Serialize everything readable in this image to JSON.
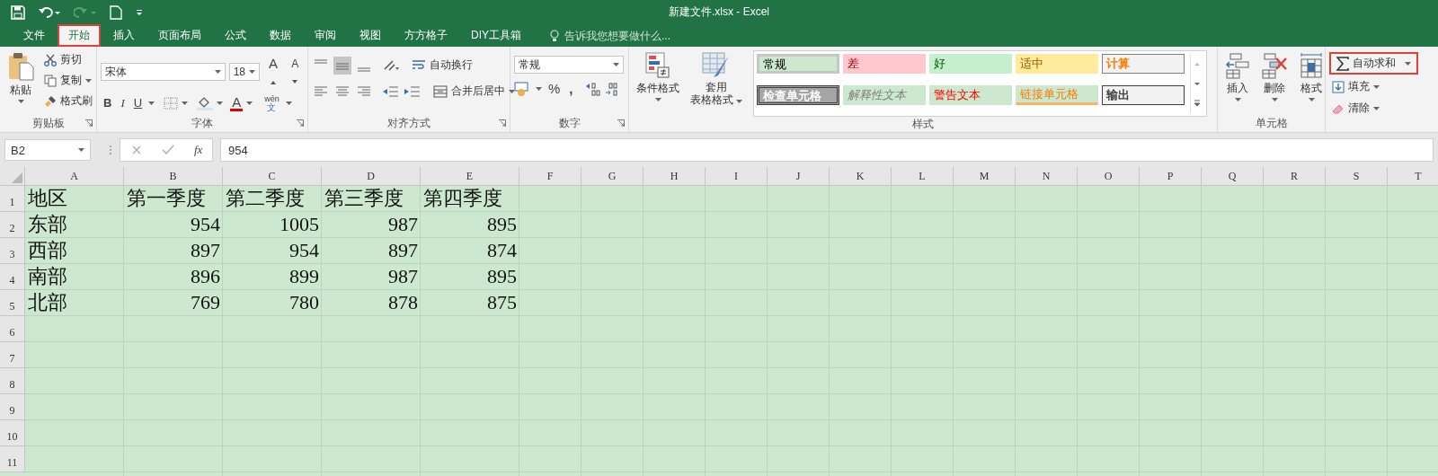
{
  "window": {
    "title": "新建文件.xlsx - Excel"
  },
  "tabs": [
    {
      "label": "文件",
      "selected": false,
      "highlighted": false
    },
    {
      "label": "开始",
      "selected": true,
      "highlighted": true
    },
    {
      "label": "插入",
      "selected": false,
      "highlighted": false
    },
    {
      "label": "页面布局",
      "selected": false,
      "highlighted": false
    },
    {
      "label": "公式",
      "selected": false,
      "highlighted": false
    },
    {
      "label": "数据",
      "selected": false,
      "highlighted": false
    },
    {
      "label": "审阅",
      "selected": false,
      "highlighted": false
    },
    {
      "label": "视图",
      "selected": false,
      "highlighted": false
    },
    {
      "label": "方方格子",
      "selected": false,
      "highlighted": false
    },
    {
      "label": "DIY工具箱",
      "selected": false,
      "highlighted": false
    }
  ],
  "tell_me": {
    "placeholder": "告诉我您想要做什么..."
  },
  "ribbon": {
    "clipboard": {
      "label": "剪贴板",
      "paste": "粘贴",
      "cut": "剪切",
      "copy": "复制",
      "format_painter": "格式刷"
    },
    "font": {
      "label": "字体",
      "font_name": "宋体",
      "font_size": "18",
      "grow_font": "A",
      "shrink_font": "A",
      "bold": "B",
      "italic": "I",
      "underline": "U",
      "font_color": "A",
      "phonetic_top": "wén",
      "phonetic_bottom": "文"
    },
    "alignment": {
      "label": "对齐方式",
      "vertical_align": [
        {
          "selected": false
        },
        {
          "selected": true
        },
        {
          "selected": false
        }
      ],
      "wrap_text": "自动换行",
      "merge_center": "合并后居中"
    },
    "number": {
      "label": "数字",
      "format": "常规",
      "percent": "%",
      "comma": ","
    },
    "styles": {
      "label": "样式",
      "conditional_formatting": "条件格式",
      "format_as_table": [
        "套用",
        "表格格式"
      ],
      "cell_styles": [
        {
          "label": "常规",
          "kind": "normal",
          "selected": true
        },
        {
          "label": "差",
          "kind": "bad",
          "selected": false
        },
        {
          "label": "好",
          "kind": "good",
          "selected": false
        },
        {
          "label": "适中",
          "kind": "neutral",
          "selected": false
        },
        {
          "label": "计算",
          "kind": "calculation",
          "selected": false
        },
        {
          "label": "检查单元格",
          "kind": "check_cell",
          "selected": false
        },
        {
          "label": "解释性文本",
          "kind": "explanatory",
          "selected": false
        },
        {
          "label": "警告文本",
          "kind": "warning",
          "selected": false
        },
        {
          "label": "链接单元格",
          "kind": "linked_cell",
          "selected": false
        },
        {
          "label": "输出",
          "kind": "output",
          "selected": false
        }
      ]
    },
    "cells": {
      "label": "单元格",
      "insert": "插入",
      "delete": "删除",
      "format": "格式"
    },
    "editing": {
      "autosum": "自动求和",
      "autosum_highlighted": true,
      "fill": "填充",
      "clear": "清除"
    }
  },
  "formula_bar": {
    "name_box": "B2",
    "function_label": "fx",
    "formula": "954"
  },
  "sheet": {
    "columns": [
      "A",
      "B",
      "C",
      "D",
      "E",
      "F",
      "G",
      "H",
      "I",
      "J",
      "K",
      "L",
      "M",
      "N",
      "O",
      "P",
      "Q",
      "R",
      "S",
      "T"
    ],
    "rows": [
      {
        "header": "1",
        "kind": "header",
        "cells": [
          "地区",
          "第一季度",
          "第二季度",
          "第三季度",
          "第四季度"
        ]
      },
      {
        "header": "2",
        "kind": "data",
        "cells": [
          "东部",
          "954",
          "1005",
          "987",
          "895"
        ]
      },
      {
        "header": "3",
        "kind": "data",
        "cells": [
          "西部",
          "897",
          "954",
          "897",
          "874"
        ]
      },
      {
        "header": "4",
        "kind": "data",
        "cells": [
          "南部",
          "896",
          "899",
          "987",
          "895"
        ]
      },
      {
        "header": "5",
        "kind": "data",
        "cells": [
          "北部",
          "769",
          "780",
          "878",
          "875"
        ]
      },
      {
        "header": "6",
        "kind": "data",
        "cells": []
      },
      {
        "header": "7",
        "kind": "data",
        "cells": []
      },
      {
        "header": "8",
        "kind": "data",
        "cells": []
      },
      {
        "header": "9",
        "kind": "data",
        "cells": []
      },
      {
        "header": "10",
        "kind": "data",
        "cells": []
      },
      {
        "header": "11",
        "kind": "data",
        "cells": []
      }
    ]
  }
}
